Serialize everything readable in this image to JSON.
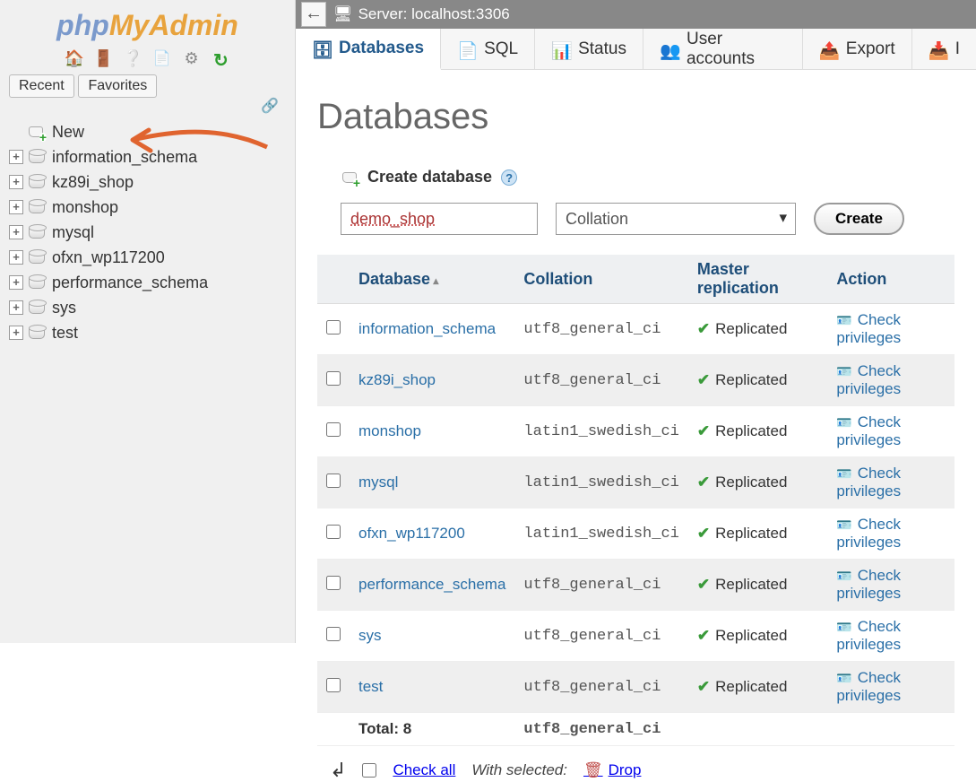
{
  "logo": {
    "part1": "php",
    "part2": "MyAdmin"
  },
  "sidebar_tabs": {
    "recent": "Recent",
    "favorites": "Favorites"
  },
  "tree": {
    "new_label": "New",
    "items": [
      "information_schema",
      "kz89i_shop",
      "monshop",
      "mysql",
      "ofxn_wp117200",
      "performance_schema",
      "sys",
      "test"
    ]
  },
  "server": {
    "label": "Server: localhost:3306"
  },
  "tabs": {
    "databases": "Databases",
    "sql": "SQL",
    "status": "Status",
    "users": "User accounts",
    "export": "Export",
    "import": "I"
  },
  "page": {
    "title": "Databases",
    "create_label": "Create database",
    "dbname_value": "demo_shop",
    "collation_placeholder": "Collation",
    "create_btn": "Create"
  },
  "table": {
    "headers": {
      "database": "Database",
      "collation": "Collation",
      "replication": "Master replication",
      "action": "Action"
    },
    "replicated_label": "Replicated",
    "check_privileges": "Check privileges",
    "rows": [
      {
        "name": "information_schema",
        "collation": "utf8_general_ci"
      },
      {
        "name": "kz89i_shop",
        "collation": "utf8_general_ci"
      },
      {
        "name": "monshop",
        "collation": "latin1_swedish_ci"
      },
      {
        "name": "mysql",
        "collation": "latin1_swedish_ci"
      },
      {
        "name": "ofxn_wp117200",
        "collation": "latin1_swedish_ci"
      },
      {
        "name": "performance_schema",
        "collation": "utf8_general_ci"
      },
      {
        "name": "sys",
        "collation": "utf8_general_ci"
      },
      {
        "name": "test",
        "collation": "utf8_general_ci"
      }
    ],
    "total_label": "Total: 8",
    "total_collation": "utf8_general_ci"
  },
  "footer": {
    "check_all": "Check all",
    "with_selected": "With selected:",
    "drop": "Drop"
  }
}
